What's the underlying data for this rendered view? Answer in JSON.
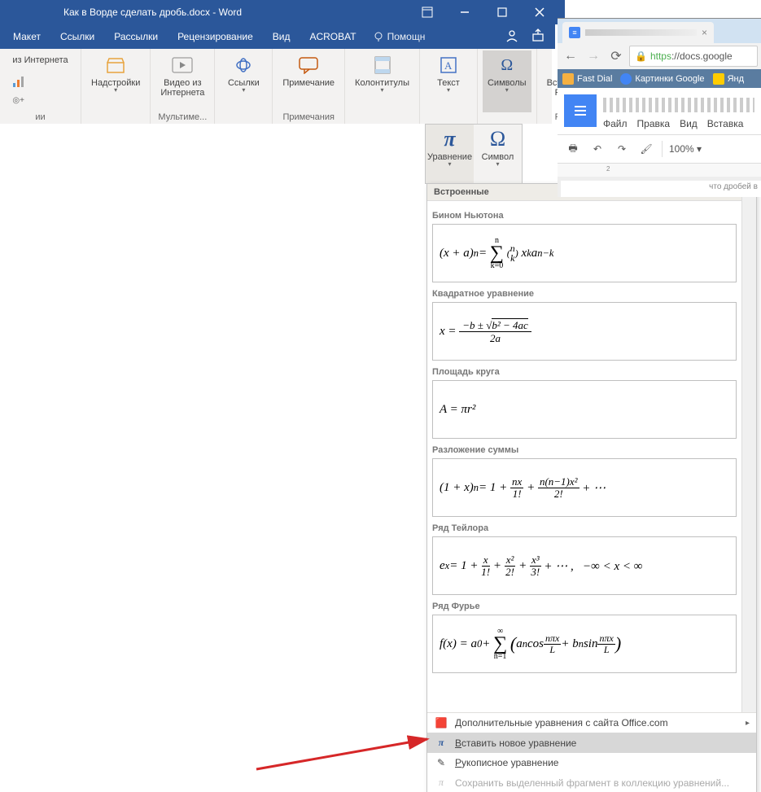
{
  "word": {
    "title": "Как в Ворде сделать дробь.docx - Word",
    "tabs": {
      "maket": "Макет",
      "links": "Ссылки",
      "mailings": "Рассылки",
      "review": "Рецензирование",
      "view": "Вид",
      "acrobat": "ACROBAT",
      "help": "Помощн"
    },
    "ribbon": {
      "internet_pane": "из Интернета",
      "chart_small": "",
      "addins": "Надстройки",
      "video": "Видео из Интернета",
      "media_group": "Мультиме...",
      "links_btn": "Ссылки",
      "comment": "Примечание",
      "comments_group": "Примечания",
      "headerfooter": "Колонтитулы",
      "text": "Текст",
      "symbols": "Символы",
      "flash": "Встроить Flash",
      "flash_group": "Flash",
      "group_empty": "ии"
    },
    "eq_ribbon": {
      "equation": "Уравнение",
      "symbol": "Символ"
    }
  },
  "gallery": {
    "header": "Встроенные",
    "items": [
      {
        "name": "Бином Ньютона"
      },
      {
        "name": "Квадратное уравнение"
      },
      {
        "name": "Площадь круга"
      },
      {
        "name": "Разложение суммы"
      },
      {
        "name": "Ряд Тейлора"
      },
      {
        "name": "Ряд Фурье"
      }
    ],
    "footer": {
      "more": "Дополнительные уравнения с сайта Office.com",
      "insert": "Вставить новое уравнение",
      "ink": "Рукописное уравнение",
      "save": "Сохранить выделенный фрагмент в коллекцию уравнений..."
    }
  },
  "chrome": {
    "tab_title": "",
    "url_prefix": "https",
    "url_rest": "://docs.google",
    "bookmarks": {
      "fastdial": "Fast Dial",
      "gimg": "Картинки Google",
      "yandex": "Янд"
    }
  },
  "docs": {
    "menus": {
      "file": "Файл",
      "edit": "Правка",
      "view": "Вид",
      "insert": "Вставка"
    },
    "zoom": "100%",
    "ruler_mark": "2",
    "page_hint": "что дробей в"
  },
  "colors": {
    "word_blue": "#2b579a",
    "google_blue": "#4285f4"
  }
}
